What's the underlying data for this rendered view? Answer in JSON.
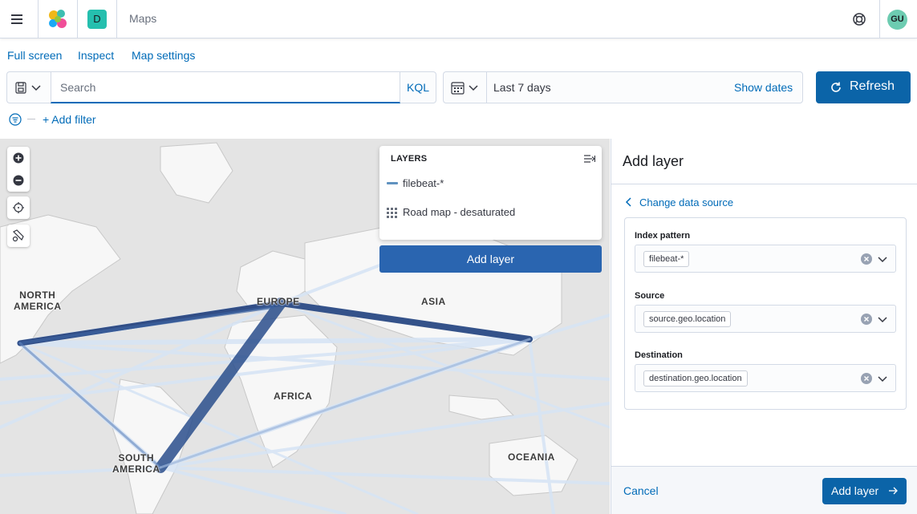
{
  "header": {
    "space_initial": "D",
    "app_title": "Maps",
    "user_initials": "GU",
    "icons": {
      "menu": "hamburger-icon",
      "logo": "elastic-logo",
      "help": "help-lifebuoy-icon"
    }
  },
  "nav": {
    "full_screen": "Full screen",
    "inspect": "Inspect",
    "map_settings": "Map settings"
  },
  "query": {
    "search_placeholder": "Search",
    "language": "KQL"
  },
  "time": {
    "range": "Last 7 days",
    "show_dates": "Show dates",
    "refresh": "Refresh"
  },
  "filters": {
    "add_filter": "+ Add filter"
  },
  "map": {
    "continents": [
      {
        "id": "north-america",
        "line1": "NORTH",
        "line2": "AMERICA"
      },
      {
        "id": "europe",
        "line1": "EUROPE",
        "line2": ""
      },
      {
        "id": "asia",
        "line1": "ASIA",
        "line2": ""
      },
      {
        "id": "africa",
        "line1": "AFRICA",
        "line2": ""
      },
      {
        "id": "south-america",
        "line1": "SOUTH",
        "line2": "AMERICA"
      },
      {
        "id": "oceania",
        "line1": "OCEANIA",
        "line2": ""
      }
    ],
    "layers_title": "LAYERS",
    "layers": [
      {
        "name": "filebeat-*",
        "icon": "line-layer-icon",
        "color": "#6092c0"
      },
      {
        "name": "Road map - desaturated",
        "icon": "tile-grid-icon"
      }
    ],
    "add_layer": "Add layer",
    "tools": [
      "zoom-in-icon",
      "zoom-out-icon",
      "crosshair-icon",
      "draw-tools-icon"
    ]
  },
  "flyout": {
    "title": "Add layer",
    "change_data_source": "Change data source",
    "fields": [
      {
        "label": "Index pattern",
        "value": "filebeat-*"
      },
      {
        "label": "Source",
        "value": "source.geo.location"
      },
      {
        "label": "Destination",
        "value": "destination.geo.location"
      }
    ],
    "cancel": "Cancel",
    "add_layer": "Add layer"
  },
  "colors": {
    "accent": "#006bb8",
    "primary_button": "#0b64a8",
    "line_dark": "#1f3d7a",
    "line_light": "#d6e4f5"
  }
}
